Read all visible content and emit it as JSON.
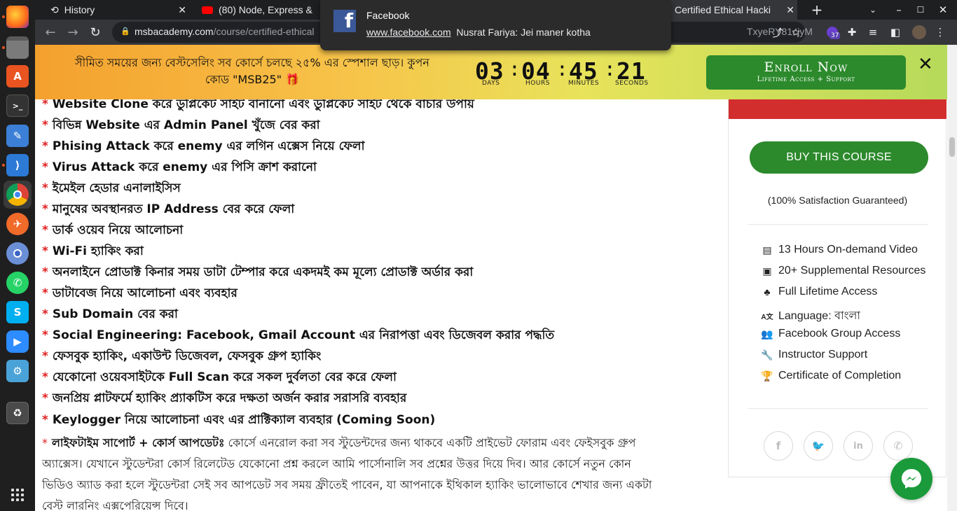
{
  "browser": {
    "tabs": [
      {
        "title": "History",
        "icon": "history-icon"
      },
      {
        "title": "(80) Node, Express & ",
        "icon": "youtube-icon"
      },
      {
        "title": "Certified Ethical Hacki",
        "icon": "site-icon"
      }
    ],
    "new_tab_label": "+",
    "url_host": "msbacademy.com",
    "url_path": "/course/certified-ethical",
    "url_tail": "TxyeRY81cjyM",
    "extension_badge": "37"
  },
  "notification": {
    "app": "Facebook",
    "source_link": "www.facebook.com",
    "message": "Nusrat Fariya: Jei maner kotha"
  },
  "promo": {
    "text": "সীমিত সময়ের জন্য বেস্টসেলিং সব কোর্সে চলছে ২৫% এর স্পেশাল ছাড়। কুপন কোড \"MSB25\" 🎁",
    "countdown": {
      "days": "03",
      "hours": "04",
      "minutes": "45",
      "seconds": "21",
      "days_label": "DAYS",
      "hours_label": "HOURS",
      "minutes_label": "MINUTES",
      "seconds_label": "SECONDS"
    },
    "enroll_label": "Enroll Now",
    "enroll_sub": "Lifetime Access + Support",
    "close": "✕"
  },
  "features": [
    "Website Clone করে ডুপ্লিকেট সাইট বানানো এবং ডুপ্লিকেট সাইট থেকে বাঁচার উপায়",
    "বিভিন্ন Website এর Admin Panel খুঁজে বের করা",
    "Phising Attack করে enemy এর লগিন এক্সেস নিয়ে ফেলা",
    "Virus Attack করে enemy এর পিসি ক্রাশ করানো",
    "ইমেইল হেডার এনালাইসিস",
    "মানুষের অবস্থানরত IP Address বের করে ফেলা",
    "ডার্ক ওয়েব নিয়ে আলোচনা",
    "Wi-Fi হ্যাকিং করা",
    "অনলাইনে প্রোডাক্ট কিনার সময় ডাটা টেম্পার করে একদমই কম মূল্যে প্রোডাক্ট অর্ডার করা",
    "ডাটাবেজ নিয়ে আলোচনা এবং ব্যবহার",
    "Sub Domain বের করা",
    "Social Engineering: Facebook, Gmail Account এর নিরাপত্তা এবং ডিজেবল করার পদ্ধতি",
    "ফেসবুক হ্যাকিং, একাউন্ট ডিজেবল, ফেসবুক গ্রুপ হ্যাকিং",
    "যেকোনো ওয়েবসাইটকে Full Scan করে সকল দুর্বলতা বের করে ফেলা",
    "জনপ্রিয় প্লাটফর্মে হ্যাকিং প্র্যাকটিস করে দক্ষতা অর্জন করার সরাসরি ব্যবহার",
    "Keylogger নিয়ে আলোচনা এবং এর প্রাক্টিক্যাল ব্যবহার (Coming Soon)"
  ],
  "support_para": {
    "lead": "লাইফটাইম সাপোর্ট + কোর্স আপডেটঃ",
    "body": " কোর্সে এনরোল করা সব স্টুডেন্টদের জন্য থাকবে একটি প্রাইভেট ফোরাম এবং ফেইসবুক গ্রুপ অ্যাক্সেস। যেখানে স্টুডেন্টরা কোর্স রিলেটেড যেকোনো প্রশ্ন করলে আমি পার্সোনালি সব প্রশ্নের উত্তর দিয়ে দিব। আর কোর্সে নতুন কোন ভিডিও অ্যাড করা হলে স্টুডেন্টরা সেই সব আপডেট সব সময় ফ্রীতেই পাবেন, যা আপনাকে ইথিকাল হ্যাকিং ভালোভাবে শেখার জন্য একটা বেস্ট লারনিং এক্সপেরিয়েন্স দিবে।"
  },
  "sidebar": {
    "buy_label": "BUY THIS COURSE",
    "guarantee": "(100% Satisfaction Guaranteed)",
    "includes": [
      {
        "icon": "file-video-icon",
        "label": "13 Hours On-demand Video"
      },
      {
        "icon": "address-book-icon",
        "label": "20+ Supplemental Resources"
      },
      {
        "icon": "seedling-icon",
        "label": "Full Lifetime Access"
      },
      {
        "icon": "language-icon",
        "label": "Language: বাংলা"
      },
      {
        "icon": "users-icon",
        "label": "Facebook Group Access"
      },
      {
        "icon": "wrench-icon",
        "label": "Instructor Support"
      },
      {
        "icon": "trophy-icon",
        "label": "Certificate of Completion"
      }
    ],
    "social": [
      "facebook-icon",
      "twitter-icon",
      "linkedin-icon",
      "whatsapp-icon"
    ]
  },
  "colors": {
    "accent_green": "#2c8a2c",
    "bullet_red": "#e02020",
    "sidebar_red": "#d32e2e",
    "messenger_green": "#1a9a3a"
  }
}
